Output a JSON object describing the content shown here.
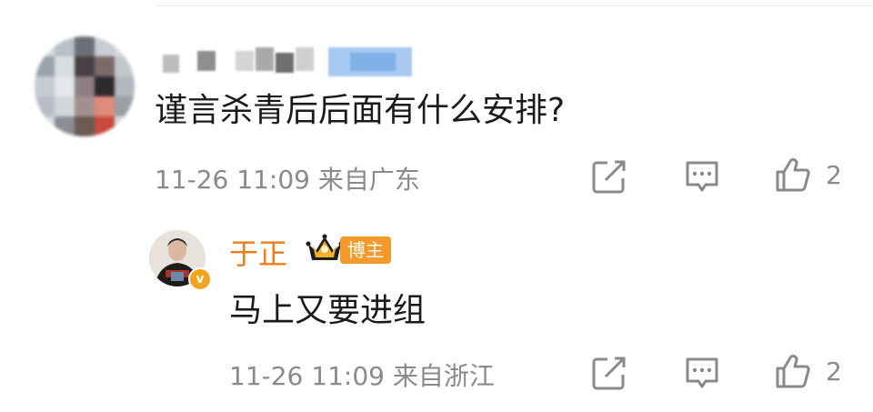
{
  "comment": {
    "text": "谨言杀青后后面有什么安排?",
    "time": "11-26 11:09",
    "location": "来自广东",
    "likes": "2",
    "actions": {
      "share": "share-icon",
      "reply": "comment-icon",
      "like": "thumbs-up-icon"
    }
  },
  "reply": {
    "author": "于正",
    "badge": "博主",
    "verified_mark": "v",
    "text": "马上又要进组",
    "time": "11-26 11:09",
    "location": "来自浙江",
    "likes": "2"
  },
  "colors": {
    "author": "#ef7c1b",
    "badge": "#f39a2a",
    "meta": "#8a8a8a",
    "text": "#1b1b1b"
  }
}
